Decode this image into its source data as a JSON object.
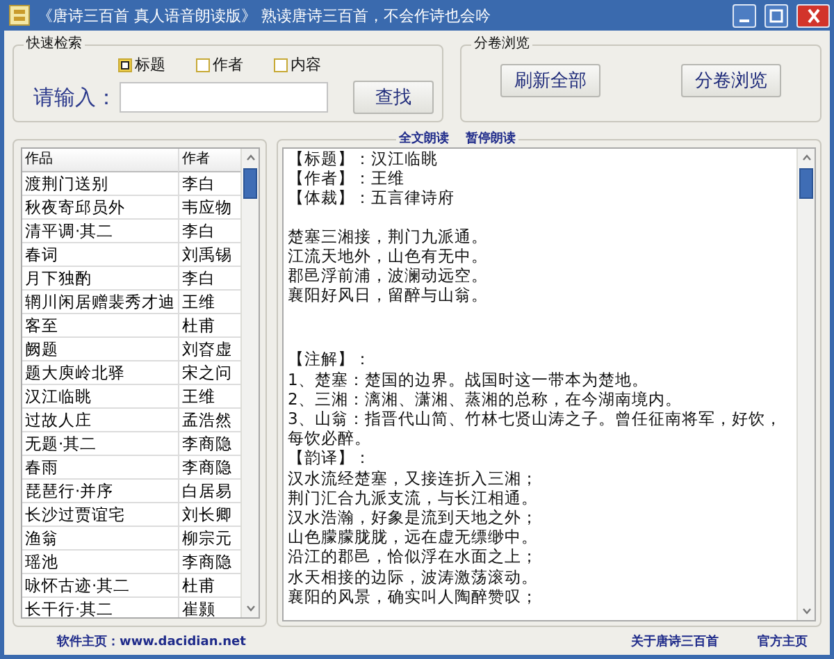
{
  "window": {
    "title": "《唐诗三百首 真人语音朗读版》 熟读唐诗三百首，不会作诗也会吟"
  },
  "quick_search": {
    "title": "快速检索",
    "options": [
      {
        "label": "标题",
        "selected": true
      },
      {
        "label": "作者",
        "selected": false
      },
      {
        "label": "内容",
        "selected": false
      }
    ],
    "input_label": "请输入：",
    "button": "查找"
  },
  "volume_browse": {
    "title": "分卷浏览",
    "buttons": [
      "刷新全部",
      "分卷浏览"
    ]
  },
  "poem_list": {
    "columns": [
      "作品",
      "作者"
    ],
    "rows": [
      [
        "渡荆门送别",
        "李白"
      ],
      [
        "秋夜寄邱员外",
        "韦应物"
      ],
      [
        "清平调·其二",
        "李白"
      ],
      [
        "春词",
        "刘禹锡"
      ],
      [
        "月下独酌",
        "李白"
      ],
      [
        "辋川闲居赠裴秀才迪",
        "王维"
      ],
      [
        "客至",
        "杜甫"
      ],
      [
        "阙题",
        "刘昚虚"
      ],
      [
        "题大庾岭北驿",
        "宋之问"
      ],
      [
        "汉江临眺",
        "王维"
      ],
      [
        "过故人庄",
        "孟浩然"
      ],
      [
        "无题·其二",
        "李商隐"
      ],
      [
        "春雨",
        "李商隐"
      ],
      [
        "琵琶行·并序",
        "白居易"
      ],
      [
        "长沙过贾谊宅",
        "刘长卿"
      ],
      [
        "渔翁",
        "柳宗元"
      ],
      [
        "瑶池",
        "李商隐"
      ],
      [
        "咏怀古迹·其二",
        "杜甫"
      ],
      [
        "长干行·其二",
        "崔颢"
      ]
    ]
  },
  "reader": {
    "links": [
      "全文朗读",
      "暂停朗读"
    ],
    "header": [
      "【标题】：汉江临眺",
      "【作者】：王维",
      "【体裁】：五言律诗府"
    ],
    "poem": [
      "楚塞三湘接，荆门九派通。",
      "江流天地外，山色有无中。",
      "郡邑浮前浦，波澜动远空。",
      "襄阳好风日，留醉与山翁。"
    ],
    "notes_heading": "【注解】：",
    "notes": [
      "1、楚塞：楚国的边界。战国时这一带本为楚地。",
      "2、三湘：漓湘、潇湘、蒸湘的总称，在今湖南境内。",
      "3、山翁：指晋代山简、竹林七贤山涛之子。曾任征南将军，好饮，每饮必醉。"
    ],
    "translation_heading": "【韵译】：",
    "translation": [
      "汉水流经楚塞，又接连折入三湘；",
      "荆门汇合九派支流，与长江相通。",
      "汉水浩瀚，好象是流到天地之外；",
      "山色朦朦胧胧，远在虚无缥缈中。",
      "沿江的郡邑，恰似浮在水面之上；",
      "水天相接的边际，波涛激荡滚动。",
      "襄阳的风景，确实叫人陶醉赞叹；"
    ]
  },
  "footer": {
    "homepage": "软件主页：www.dacidian.net",
    "about": "关于唐诗三百首",
    "official": "官方主页"
  }
}
